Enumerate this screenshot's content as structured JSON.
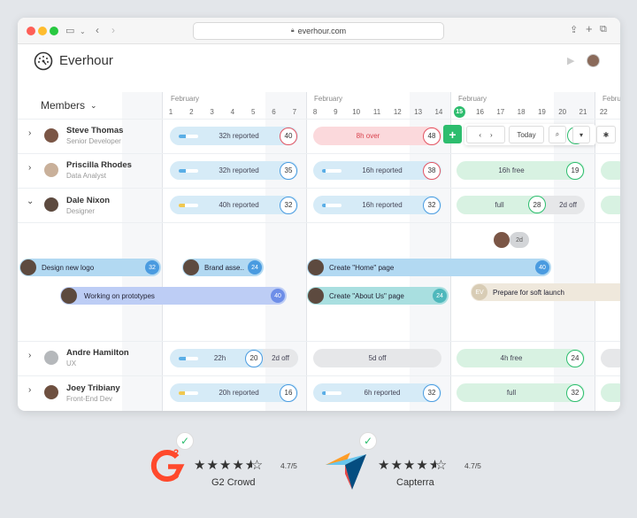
{
  "browser": {
    "url": "everhour.com"
  },
  "app": {
    "title": "Everhour"
  },
  "members_header": {
    "label": "Members"
  },
  "timeline": {
    "months": [
      {
        "label": "February"
      },
      {
        "label": "February"
      },
      {
        "label": "February"
      },
      {
        "label": "Febru"
      }
    ],
    "days": [
      "1",
      "2",
      "3",
      "4",
      "5",
      "6",
      "7",
      "8",
      "9",
      "10",
      "11",
      "12",
      "13",
      "14",
      "15",
      "16",
      "17",
      "18",
      "19",
      "20",
      "21",
      "22"
    ],
    "today": "15"
  },
  "toolbar": {
    "today_label": "Today"
  },
  "members": [
    {
      "name": "Steve Thomas",
      "role": "Senior Developer"
    },
    {
      "name": "Priscilla Rhodes",
      "role": "Data Analyst"
    },
    {
      "name": "Dale Nixon",
      "role": "Designer"
    },
    {
      "name": "Andre Hamilton",
      "role": "UX"
    },
    {
      "name": "Joey Tribiany",
      "role": "Front-End Dev"
    }
  ],
  "capacity": {
    "steve": [
      {
        "label": "32h reported",
        "value": "40",
        "progress": 0.35
      },
      {
        "label": "8h over",
        "value": "48"
      }
    ],
    "priscilla": [
      {
        "label": "32h reported",
        "value": "35",
        "progress": 0.35
      },
      {
        "label": "16h reported",
        "value": "38",
        "progress": 0.2
      },
      {
        "label": "16h free",
        "value": "19"
      }
    ],
    "dale": [
      {
        "label": "40h reported",
        "value": "32",
        "progress": 0.3
      },
      {
        "label": "16h reported",
        "value": "32",
        "progress": 0.2
      },
      {
        "label": "full",
        "value": "28",
        "extra": "2d off"
      }
    ],
    "andre": [
      {
        "label": "22h",
        "value": "20",
        "extra": "2d off",
        "progress": 0.35
      },
      {
        "label": "5d off"
      },
      {
        "label": "4h free",
        "value": "24"
      }
    ],
    "joey": [
      {
        "label": "20h reported",
        "value": "16",
        "progress": 0.3
      },
      {
        "label": "6h reported",
        "value": "32",
        "progress": 0.2
      },
      {
        "label": "full",
        "value": "32"
      }
    ]
  },
  "tasks": [
    {
      "label": "Design new logo",
      "badge": "32"
    },
    {
      "label": "Brand asse..",
      "badge": "24"
    },
    {
      "label": "Create \"Home\" page",
      "badge": "40"
    },
    {
      "label": "Working on prototypes",
      "badge": "40"
    },
    {
      "label": "Create \"About Us\" page",
      "badge": "24"
    },
    {
      "label": "Prepare for soft launch",
      "avatar_initials": "EV"
    }
  ],
  "floating_badge": {
    "value": "2d"
  },
  "ratings": [
    {
      "name": "G2 Crowd",
      "score": "4.7/5",
      "logo_text": "2"
    },
    {
      "name": "Capterra",
      "score": "4.7/5"
    }
  ],
  "colors": {
    "accent_green": "#2dbd6e",
    "reported_blue": "#d6ebf7",
    "over_red": "#fbd9dc",
    "free_green": "#d8f2e2",
    "off_grey": "#e6e7e9",
    "task_blue": "#b2d9f2",
    "task_purple": "#bdcdf5",
    "task_teal": "#a9dfe0",
    "task_beige": "#efe8dc"
  }
}
